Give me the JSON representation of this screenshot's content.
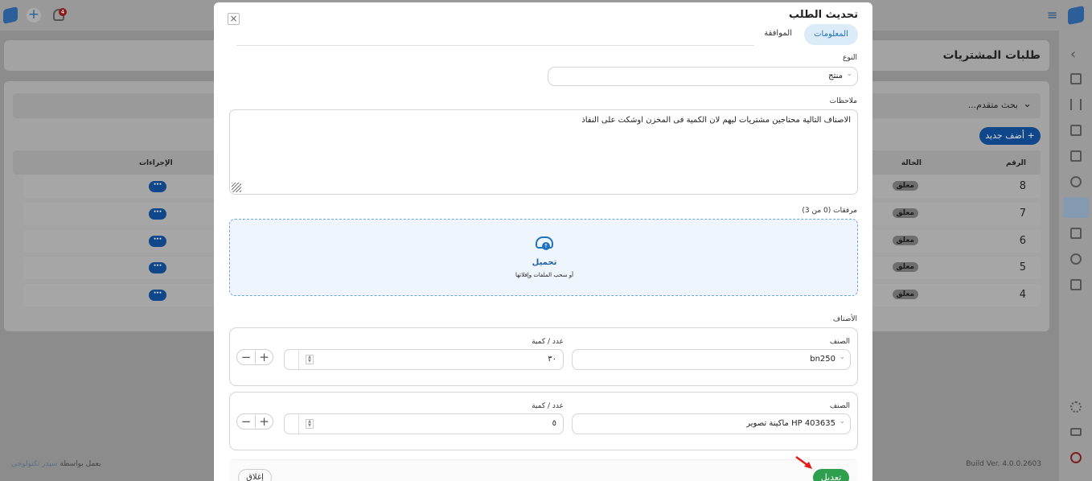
{
  "topbar": {
    "notification_count": "4"
  },
  "page": {
    "title": "طلبات المشتريات",
    "add_button": "أضف جديد",
    "advanced_search": "بحث متقدم...",
    "footer_build": "Build Ver. 4.0.0.2603",
    "footer_powered_prefix": "يعمل بواسطة",
    "footer_powered_company": "سيدر تكنولوجي"
  },
  "table": {
    "columns": [
      "الرقم",
      "الحالة",
      "الإجراءات"
    ],
    "rows": [
      {
        "number": "8",
        "status": "معلق",
        "action": "···"
      },
      {
        "number": "7",
        "status": "معلق",
        "action": "···"
      },
      {
        "number": "6",
        "status": "معلق",
        "action": "···"
      },
      {
        "number": "5",
        "status": "معلق",
        "action": "···"
      },
      {
        "number": "4",
        "status": "معلق",
        "action": "···"
      }
    ]
  },
  "modal": {
    "title": "تحديث الطلب",
    "tabs": [
      {
        "label": "المعلومات",
        "active": true
      },
      {
        "label": "الموافقة",
        "active": false
      }
    ],
    "type_label": "النوع",
    "type_value": "منتج",
    "notes_label": "ملاحظات",
    "notes_value": "الاصناف التالية محتاجين مشتريات ليهم لان الكمية فى المخزن اوشكت على النفاذ",
    "attachments_label": "مرفقات (0 من 3)",
    "upload_title": "تحميل",
    "upload_hint": "أو سحب الملفات وإفلاتها",
    "items_label": "الأصناف",
    "items": [
      {
        "item_label": "الصنف",
        "item_value": "bn250",
        "qty_label": "عدد / كمية",
        "qty_value": "٣٠"
      },
      {
        "item_label": "الصنف",
        "item_value": "HP 403635 ماكينة تصوير",
        "qty_label": "عدد / كمية",
        "qty_value": "٥"
      }
    ],
    "submit_label": "تعديل",
    "close_label": "إغلاق"
  },
  "colors": {
    "primary": "#1e73be",
    "success": "#2e9e4f",
    "overlay": "#8c8c8c"
  }
}
